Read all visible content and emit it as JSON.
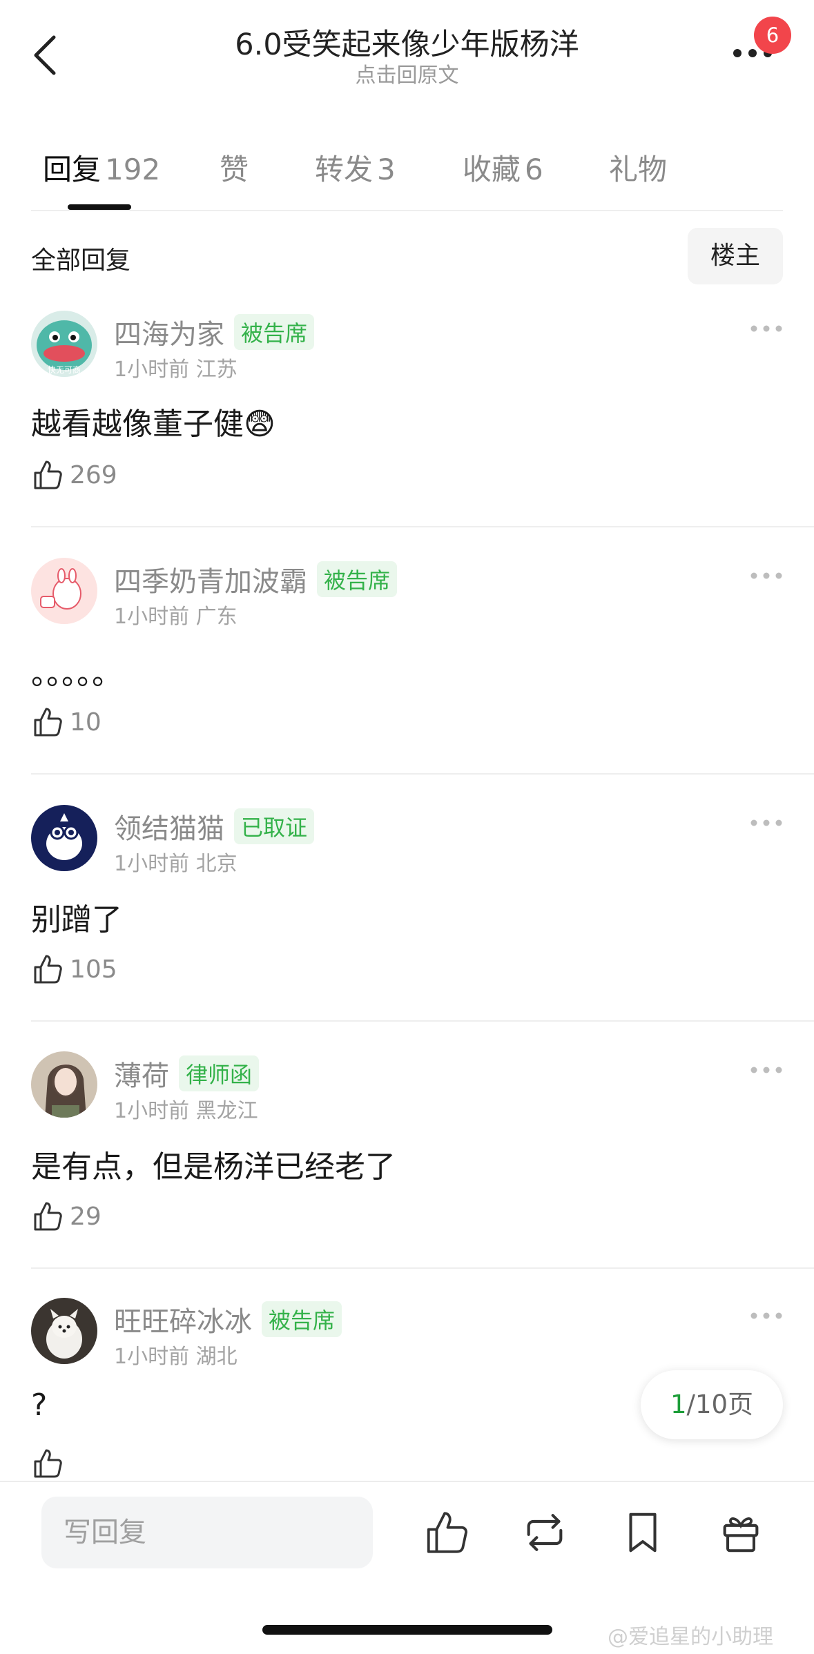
{
  "header": {
    "title": "6.0受笑起来像少年版杨洋",
    "subtitle": "点击回原文",
    "notification_count": "6"
  },
  "tabs": [
    {
      "label": "回复",
      "count": "192"
    },
    {
      "label": "赞",
      "count": ""
    },
    {
      "label": "转发",
      "count": "3"
    },
    {
      "label": "收藏",
      "count": "6"
    },
    {
      "label": "礼物",
      "count": ""
    }
  ],
  "section": {
    "title": "全部回复",
    "filter_button": "楼主"
  },
  "comments": [
    {
      "username": "四海为家",
      "tag": "被告席",
      "time": "1小时前",
      "location": "江苏",
      "text": "越看越像董子健😨",
      "likes": "269",
      "avatar_text": "快无可商"
    },
    {
      "username": "四季奶青加波霸",
      "tag": "被告席",
      "time": "1小时前",
      "location": "广东",
      "text": "。。。。。",
      "likes": "10"
    },
    {
      "username": "领结猫猫",
      "tag": "已取证",
      "time": "1小时前",
      "location": "北京",
      "text": "别蹭了",
      "likes": "105"
    },
    {
      "username": "薄荷",
      "tag": "律师函",
      "time": "1小时前",
      "location": "黑龙江",
      "text": "是有点，但是杨洋已经老了",
      "likes": "29"
    },
    {
      "username": "旺旺碎冰冰",
      "tag": "被告席",
      "time": "1小时前",
      "location": "湖北",
      "text": "?",
      "likes": ""
    }
  ],
  "pager": {
    "current": "1",
    "total": "/10页"
  },
  "bottom_bar": {
    "reply_placeholder": "写回复"
  },
  "watermark": "@爱追星的小助理",
  "icons": [
    "back-arrow-icon",
    "more-icon",
    "thumb-up-icon",
    "repost-icon",
    "bookmark-icon",
    "gift-icon"
  ],
  "colors": {
    "accent_green": "#34b24a",
    "badge_red": "#f2454b"
  }
}
